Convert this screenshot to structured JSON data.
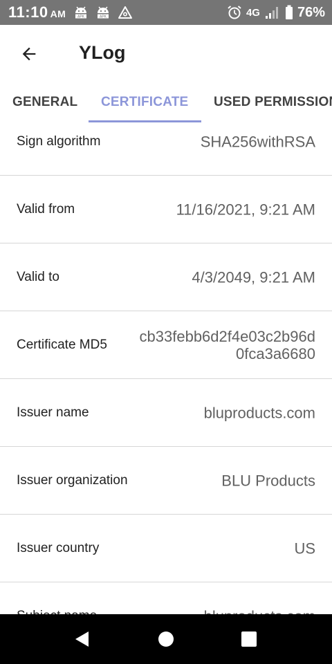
{
  "status_bar": {
    "time": "11:10",
    "ampm": "AM",
    "network": "4G",
    "battery": "76%",
    "icons": [
      "android-apk-icon",
      "android-apk-icon",
      "app-triangle-icon",
      "alarm-icon",
      "signal-icon",
      "battery-icon"
    ]
  },
  "app_bar": {
    "title": "YLog",
    "back_icon": "arrow-back-icon"
  },
  "tabs": [
    {
      "label": "GENERAL",
      "selected": false
    },
    {
      "label": "CERTIFICATE",
      "selected": true
    },
    {
      "label": "USED PERMISSIONS",
      "selected": false
    }
  ],
  "rows": [
    {
      "label": "Sign algorithm",
      "value": "SHA256withRSA"
    },
    {
      "label": "Valid from",
      "value": "11/16/2021, 9:21 AM"
    },
    {
      "label": "Valid to",
      "value": "4/3/2049, 9:21 AM"
    },
    {
      "label": "Certificate MD5",
      "value": "cb33febb6d2f4e03c2b96d0fca3a6680"
    },
    {
      "label": "Issuer name",
      "value": "bluproducts.com"
    },
    {
      "label": "Issuer organization",
      "value": "BLU Products"
    },
    {
      "label": "Issuer country",
      "value": "US"
    },
    {
      "label": "Subject name",
      "value": "bluproducts.com"
    }
  ],
  "nav_bar": {
    "icons": [
      "back-triangle-icon",
      "home-circle-icon",
      "recents-square-icon"
    ]
  },
  "colors": {
    "accent": "#8c96d9",
    "status_bar": "#757575",
    "nav_bar": "#000000",
    "divider": "#d6d6d6"
  }
}
